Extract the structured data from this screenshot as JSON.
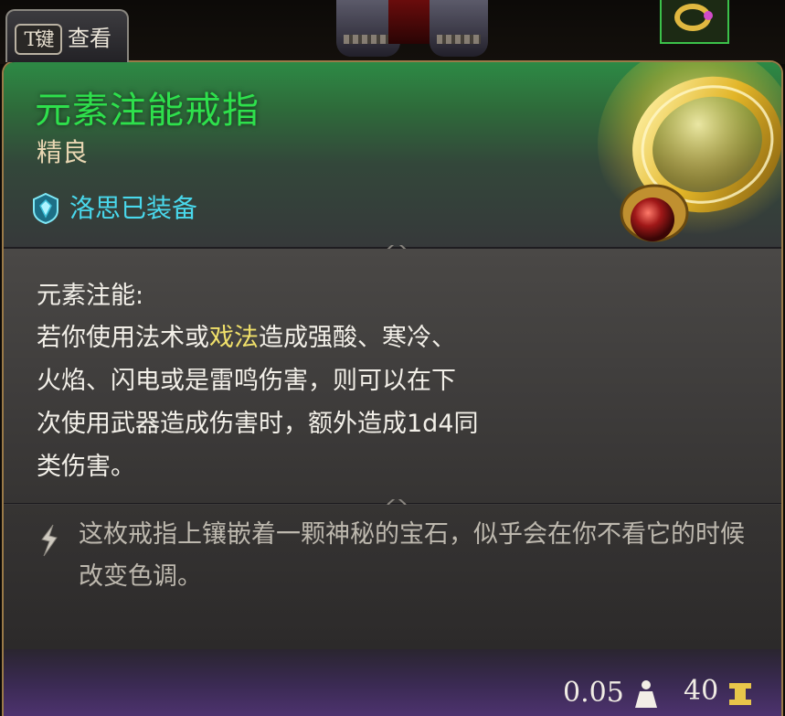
{
  "hotkey": {
    "key": "T键",
    "label": "查看"
  },
  "item": {
    "name": "元素注能戒指",
    "rarity": "精良",
    "equipped_by": "洛思已装备",
    "name_color": "#2ee04c",
    "rarity_color": "#e8d6b2",
    "equipped_color": "#49d8ec"
  },
  "description": {
    "heading": "元素注能:",
    "line1_pre": "若你使用法术或",
    "line1_highlight": "戏法",
    "line1_post": "造成强酸、寒冷、",
    "line2": "火焰、闪电或是雷鸣伤害，则可以在下",
    "line3": "次使用武器造成伤害时，额外造成1d4同",
    "line4": "类伤害。",
    "highlight_color": "#f0e06a"
  },
  "flavor": {
    "text": "这枚戒指上镶嵌着一颗神秘的宝石，似乎会在你不看它的时候改变色调。"
  },
  "footer": {
    "weight": "0.05",
    "weight_icon": "weight-icon",
    "value": "40",
    "value_icon": "gold-coin-icon"
  },
  "icons": {
    "equip": "shield-gem-icon",
    "flavor": "quill-icon",
    "item_art": "ring-icon"
  }
}
